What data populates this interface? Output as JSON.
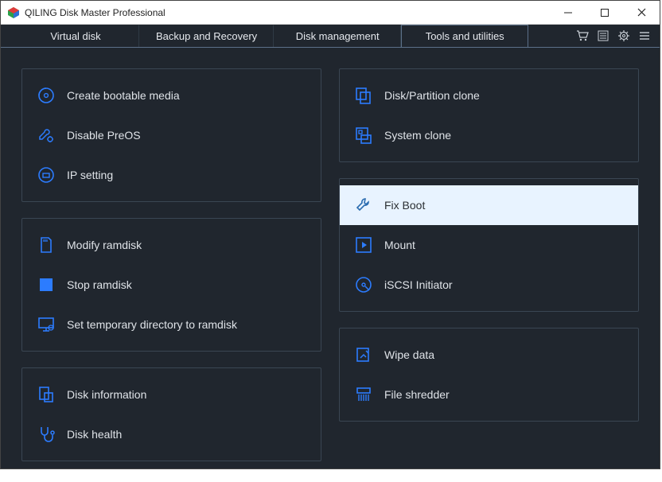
{
  "window": {
    "title": "QILING Disk Master Professional"
  },
  "tabs": {
    "t0": "Virtual disk",
    "t1": "Backup and Recovery",
    "t2": "Disk management",
    "t3": "Tools and utilities"
  },
  "left": {
    "g0": {
      "i0": "Create bootable media",
      "i1": "Disable PreOS",
      "i2": "IP setting"
    },
    "g1": {
      "i0": "Modify ramdisk",
      "i1": "Stop ramdisk",
      "i2": "Set temporary directory to ramdisk"
    },
    "g2": {
      "i0": "Disk information",
      "i1": "Disk health"
    }
  },
  "right": {
    "g0": {
      "i0": "Disk/Partition clone",
      "i1": "System clone"
    },
    "g1": {
      "i0": "Fix Boot",
      "i1": "Mount",
      "i2": "iSCSI Initiator"
    },
    "g2": {
      "i0": "Wipe data",
      "i1": "File shredder"
    }
  }
}
